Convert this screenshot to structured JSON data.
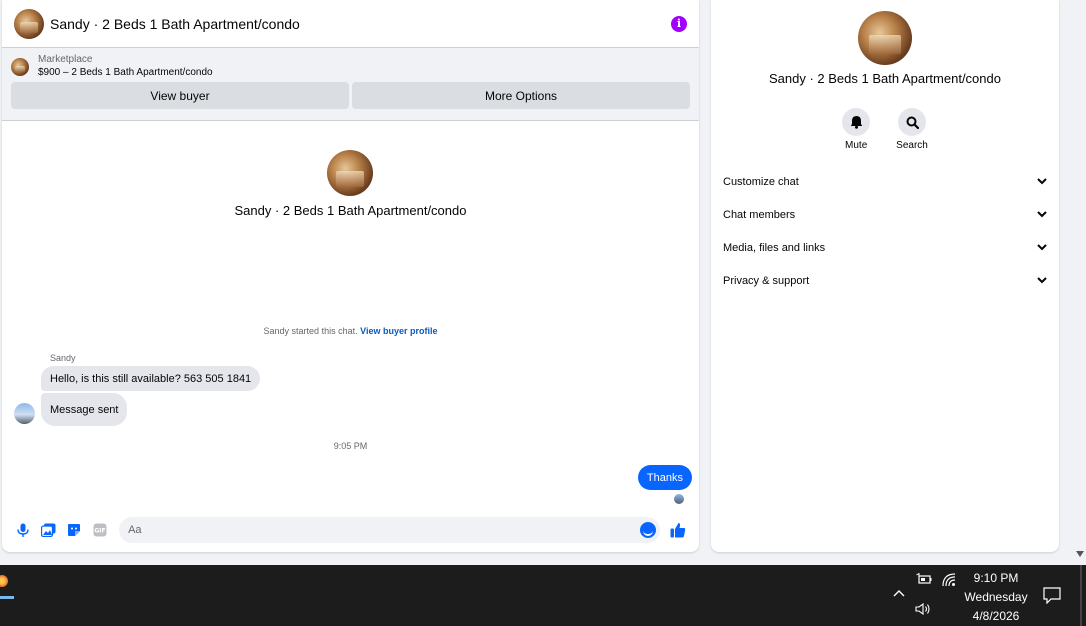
{
  "chat": {
    "title": "Sandy · 2 Beds 1 Bath Apartment/condo",
    "marketplace_label": "Marketplace",
    "listing": "$900 – 2 Beds 1 Bath Apartment/condo",
    "view_buyer": "View buyer",
    "more_options": "More Options",
    "center_title": "Sandy · 2 Beds 1 Bath Apartment/condo",
    "started_text": "Sandy started this chat.",
    "buyer_profile_link": "View buyer profile",
    "sender_name": "Sandy",
    "messages_in": [
      "Hello, is this still available? 563 505 1841",
      "Message sent"
    ],
    "timestamp": "9:05 PM",
    "message_out": "Thanks",
    "composer_placeholder": "Aa"
  },
  "side": {
    "title": "Sandy · 2 Beds 1 Bath Apartment/condo",
    "mute": "Mute",
    "search": "Search",
    "items": [
      "Customize chat",
      "Chat members",
      "Media, files and links",
      "Privacy & support"
    ]
  },
  "taskbar": {
    "time": "9:10 PM",
    "day": "Wednesday",
    "date": "4/8/2026"
  },
  "colors": {
    "accent": "#0866ff",
    "info": "#a100ff",
    "link": "#0a5bbf"
  },
  "icons": [
    "info-icon",
    "microphone-icon",
    "photo-icon",
    "sticker-icon",
    "gif-icon",
    "emoji-icon",
    "thumbs-up-icon",
    "bell-icon",
    "search-icon",
    "chevron-down-icon",
    "battery-icon",
    "wifi-icon",
    "volume-icon",
    "notification-icon"
  ]
}
